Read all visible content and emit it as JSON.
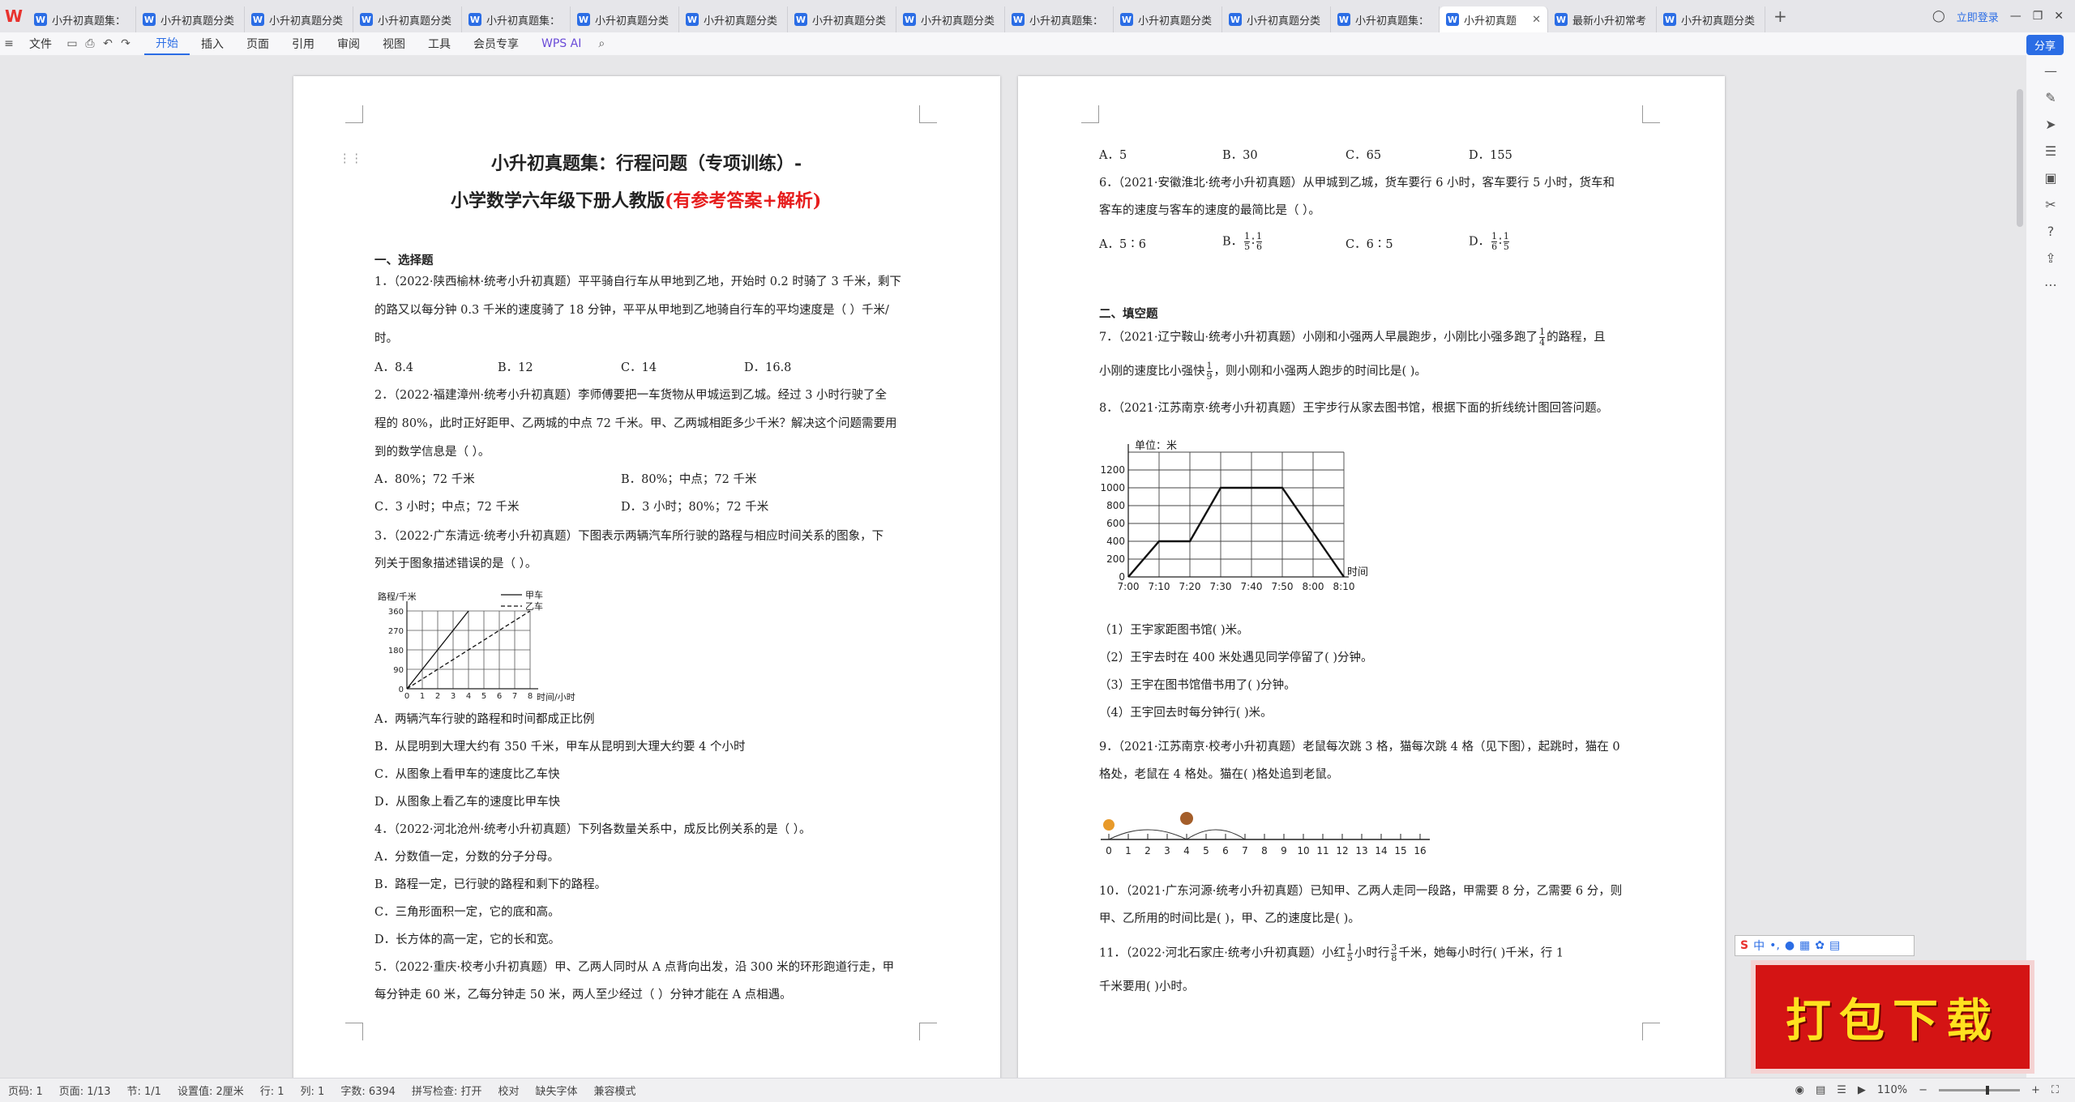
{
  "tabbar": {
    "tabs": [
      {
        "label": "小升初真题集：",
        "active": false
      },
      {
        "label": "小升初真题分类",
        "active": false
      },
      {
        "label": "小升初真题分类",
        "active": false
      },
      {
        "label": "小升初真题分类",
        "active": false
      },
      {
        "label": "小升初真题集：",
        "active": false
      },
      {
        "label": "小升初真题分类",
        "active": false
      },
      {
        "label": "小升初真题分类",
        "active": false
      },
      {
        "label": "小升初真题分类",
        "active": false
      },
      {
        "label": "小升初真题分类",
        "active": false
      },
      {
        "label": "小升初真题集：",
        "active": false
      },
      {
        "label": "小升初真题分类",
        "active": false
      },
      {
        "label": "小升初真题分类",
        "active": false
      },
      {
        "label": "小升初真题集：",
        "active": false
      },
      {
        "label": "小升初真题",
        "active": true
      },
      {
        "label": "最新小升初常考",
        "active": false
      },
      {
        "label": "小升初真题分类",
        "active": false
      }
    ],
    "login_label": "立即登录"
  },
  "menubar": {
    "file_label": "文件",
    "items": [
      "开始",
      "插入",
      "页面",
      "引用",
      "审阅",
      "视图",
      "工具",
      "会员专享"
    ],
    "wps_ai_label": "WPS AI",
    "share_label": "分享"
  },
  "page1": {
    "title1": "小升初真题集：行程问题（专项训练）-",
    "title2a": "小学数学六年级下册人教版",
    "title2b": "(有参考答案+解析)",
    "section1": "一、选择题",
    "q1_l1": "1．（2022·陕西榆林·统考小升初真题）平平骑自行车从甲地到乙地，开始时 0.2 时骑了 3 千米，剩下",
    "q1_l2": "的路又以每分钟 0.3 千米的速度骑了 18 分钟，平平从甲地到乙地骑自行车的平均速度是（    ）千米/",
    "q1_l3": "时。",
    "q1_opts": [
      "A．8.4",
      "B．12",
      "C．14",
      "D．16.8"
    ],
    "q2_l1": "2．（2022·福建漳州·统考小升初真题）李师傅要把一车货物从甲城运到乙城。经过 3 小时行驶了全",
    "q2_l2": "程的 80%，此时正好距甲、乙两城的中点 72 千米。甲、乙两城相距多少千米？解决这个问题需要用",
    "q2_l3": "到的数学信息是（    ）。",
    "q2_opts": [
      "A．80%；72 千米",
      "B．80%；中点；72 千米",
      "C．3 小时；中点；72 千米",
      "D．3 小时；80%；72 千米"
    ],
    "q3_l1": "3．（2022·广东清远·统考小升初真题）下图表示两辆汽车所行驶的路程与相应时间关系的图象，下",
    "q3_l2": "列关于图象描述错误的是（    ）。",
    "q3_opts": [
      "A．两辆汽车行驶的路程和时间都成正比例",
      "B．从昆明到大理大约有 350 千米，甲车从昆明到大理大约要 4 个小时",
      "C．从图象上看甲车的速度比乙车快",
      "D．从图象上看乙车的速度比甲车快"
    ],
    "q4_l1": "4．（2022·河北沧州·统考小升初真题）下列各数量关系中，成反比例关系的是（    ）。",
    "q4_opts": [
      "A．分数值一定，分数的分子分母。",
      "B．路程一定，已行驶的路程和剩下的路程。",
      "C．三角形面积一定，它的底和高。",
      "D．长方体的高一定，它的长和宽。"
    ],
    "q5_l1": "5．（2022·重庆·校考小升初真题）甲、乙两人同时从 A 点背向出发，沿 300 米的环形跑道行走，甲",
    "q5_l2": "每分钟走 60 米，乙每分钟走 50 米，两人至少经过（    ）分钟才能在 A 点相遇。"
  },
  "chart_small": {
    "type": "line",
    "ylabel": "路程/千米",
    "xlabel": "时间/小时",
    "x": [
      0,
      1,
      2,
      3,
      4,
      5,
      6,
      7,
      8
    ],
    "yticks": [
      0,
      90,
      180,
      270,
      360
    ],
    "ylim": [
      0,
      360
    ],
    "series": [
      {
        "name": "甲车",
        "points": [
          [
            0,
            0
          ],
          [
            4,
            360
          ]
        ],
        "style": "solid"
      },
      {
        "name": "乙车",
        "points": [
          [
            0,
            0
          ],
          [
            8,
            360
          ]
        ],
        "style": "dashed"
      }
    ]
  },
  "page2": {
    "q5_opts": [
      "A．5",
      "B．30",
      "C．65",
      "D．155"
    ],
    "q6_l1": "6．（2021·安徽淮北·统考小升初真题）从甲城到乙城，货车要行 6 小时，客车要行 5 小时，货车和",
    "q6_l2": "客车的速度与客车的速度的最简比是（    ）。",
    "q6_opts": [
      "A．5∶6",
      "B．",
      "C．6∶5",
      "D．"
    ],
    "q6_frac_b": [
      "1",
      "5",
      "1",
      "6"
    ],
    "q6_frac_d": [
      "1",
      "6",
      "1",
      "5"
    ],
    "ratio_sep": "∶",
    "section2": "二、填空题",
    "q7_l1a": "7．（2021·辽宁鞍山·统考小升初真题）小刚和小强两人早晨跑步，小刚比小强多跑了",
    "q7_frac1": [
      "1",
      "4"
    ],
    "q7_l1b": "的路程，且",
    "q7_l2a": "小刚的速度比小强快",
    "q7_frac2": [
      "1",
      "9"
    ],
    "q7_l2b": "，则小刚和小强两人跑步的时间比是(          )。",
    "q8_l1": "8．（2021·江苏南京·统考小升初真题）王宇步行从家去图书馆，根据下面的折线统计图回答问题。",
    "q8_sub": [
      "（1）王宇家距图书馆(          )米。",
      "（2）王宇去时在 400 米处遇见同学停留了(          )分钟。",
      "（3）王宇在图书馆借书用了(          )分钟。",
      "（4）王宇回去时每分钟行(          )米。"
    ],
    "q9_l1": "9．（2021·江苏南京·校考小升初真题）老鼠每次跳 3 格，猫每次跳 4 格（见下图），起跳时，猫在 0",
    "q9_l2": "格处，老鼠在 4 格处。猫在(          )格处追到老鼠。",
    "q10_l1": "10．（2021·广东河源·统考小升初真题）已知甲、乙两人走同一段路，甲需要 8 分，乙需要 6 分，则",
    "q10_l2": "甲、乙所用的时间比是(          )，甲、乙的速度比是(          )。",
    "q11_l1a": "11．（2022·河北石家庄·统考小升初真题）小红",
    "q11_frac1": [
      "1",
      "5"
    ],
    "q11_l1b": "小时行",
    "q11_frac2": [
      "3",
      "8"
    ],
    "q11_l1c": "千米，她每小时行(            )千米，行 1",
    "q11_l2": "千米要用(            )小时。"
  },
  "chart_big": {
    "type": "line",
    "ylabel": "单位：米",
    "xlabel": "时间",
    "categories": [
      "7:00",
      "7:10",
      "7:20",
      "7:30",
      "7:40",
      "7:50",
      "8:00",
      "8:10"
    ],
    "yticks": [
      0,
      200,
      400,
      600,
      800,
      1000,
      1200
    ],
    "ylim": [
      0,
      1400
    ],
    "values": [
      0,
      400,
      400,
      1000,
      1000,
      1000,
      500,
      0
    ]
  },
  "numberline": {
    "ticks": [
      "0",
      "1",
      "2",
      "3",
      "4",
      "5",
      "6",
      "7",
      "8",
      "9",
      "10",
      "11",
      "12",
      "13",
      "14",
      "15",
      "16"
    ]
  },
  "ime": {
    "label": "中"
  },
  "download": {
    "label": "打包下载"
  },
  "statusbar": {
    "items": [
      "页码: 1",
      "页面: 1/13",
      "节: 1/1",
      "设置值: 2厘米",
      "行: 1",
      "列: 1",
      "字数: 6394",
      "拼写检查: 打开",
      "校对",
      "缺失字体",
      "兼容模式"
    ],
    "zoom": "110%"
  }
}
